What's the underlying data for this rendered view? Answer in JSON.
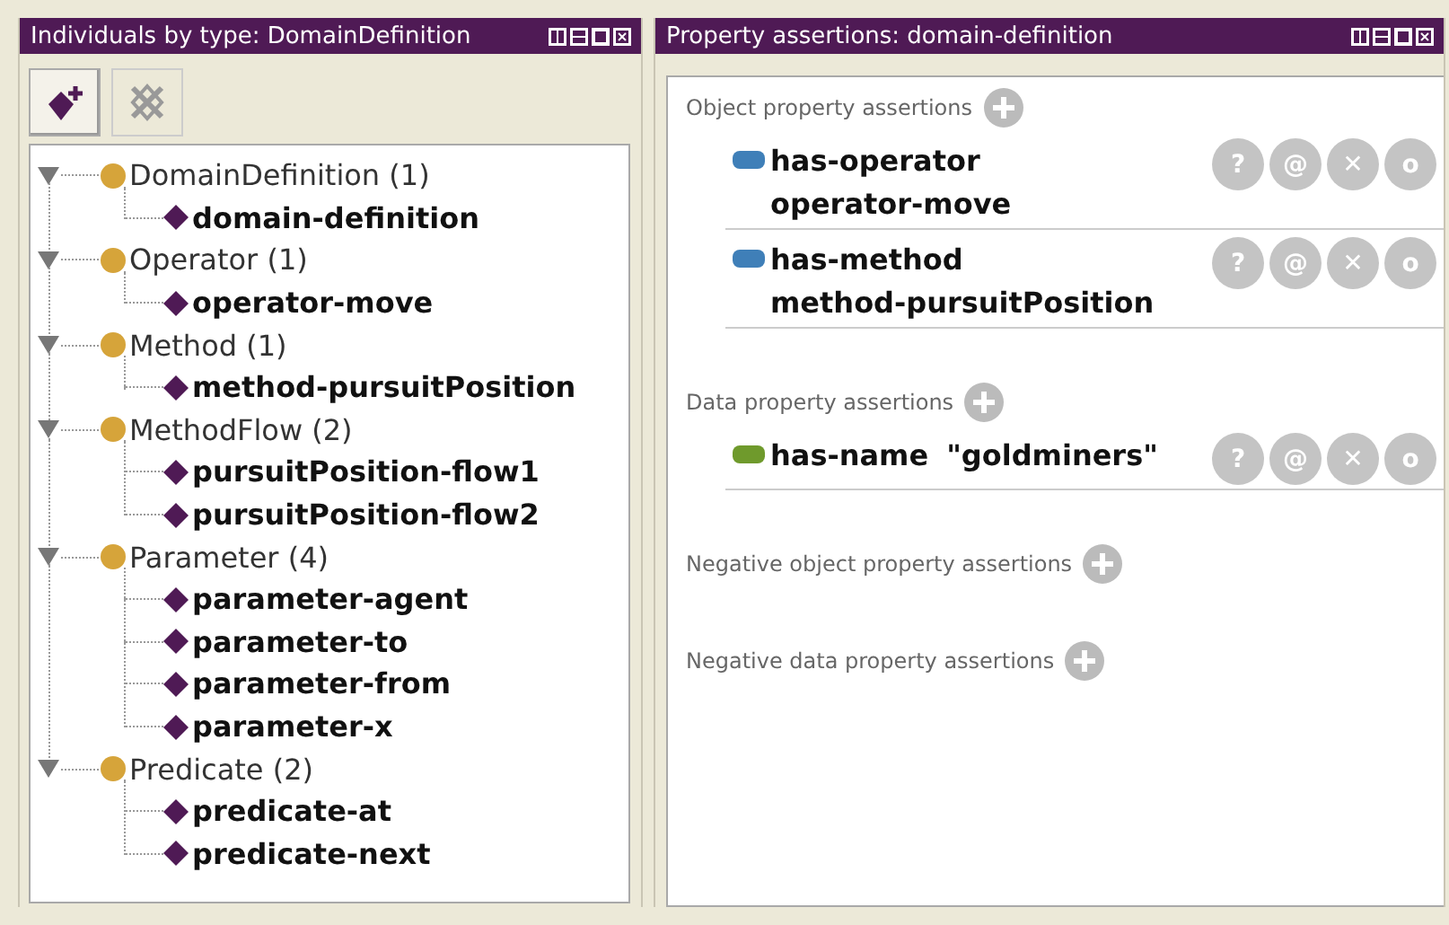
{
  "left_panel": {
    "title": "Individuals by type: DomainDefinition",
    "toolbar": [
      {
        "kind": "add",
        "disabled": false
      },
      {
        "kind": "delete",
        "disabled": true
      }
    ],
    "tree": [
      {
        "label": "DomainDefinition (1)",
        "expanded": true,
        "children": [
          {
            "label": "domain-definition"
          }
        ]
      },
      {
        "label": "Operator (1)",
        "expanded": true,
        "children": [
          {
            "label": "operator-move"
          }
        ]
      },
      {
        "label": "Method (1)",
        "expanded": true,
        "children": [
          {
            "label": "method-pursuitPosition"
          }
        ]
      },
      {
        "label": "MethodFlow (2)",
        "expanded": true,
        "children": [
          {
            "label": "pursuitPosition-flow1"
          },
          {
            "label": "pursuitPosition-flow2"
          }
        ]
      },
      {
        "label": "Parameter (4)",
        "expanded": true,
        "children": [
          {
            "label": "parameter-agent"
          },
          {
            "label": "parameter-to"
          },
          {
            "label": "parameter-from"
          },
          {
            "label": "parameter-x"
          }
        ]
      },
      {
        "label": "Predicate (2)",
        "expanded": true,
        "children": [
          {
            "label": "predicate-at"
          },
          {
            "label": "predicate-next"
          }
        ]
      }
    ]
  },
  "right_panel": {
    "title": "Property assertions: domain-definition",
    "sections": [
      {
        "label": "Object property assertions",
        "assertions": [
          {
            "kind": "object",
            "property": "has-operator",
            "value": "operator-move",
            "actions": [
              "?",
              "@",
              "✕",
              "o"
            ]
          },
          {
            "kind": "object",
            "property": "has-method",
            "value": "method-pursuitPosition",
            "actions": [
              "?",
              "@",
              "✕",
              "o"
            ]
          }
        ]
      },
      {
        "label": "Data property assertions",
        "assertions": [
          {
            "kind": "data",
            "property": "has-name",
            "value": "\"goldminers\"",
            "actions": [
              "?",
              "@",
              "✕",
              "o"
            ]
          }
        ]
      },
      {
        "label": "Negative object property assertions"
      },
      {
        "label": "Negative data property assertions"
      }
    ]
  }
}
